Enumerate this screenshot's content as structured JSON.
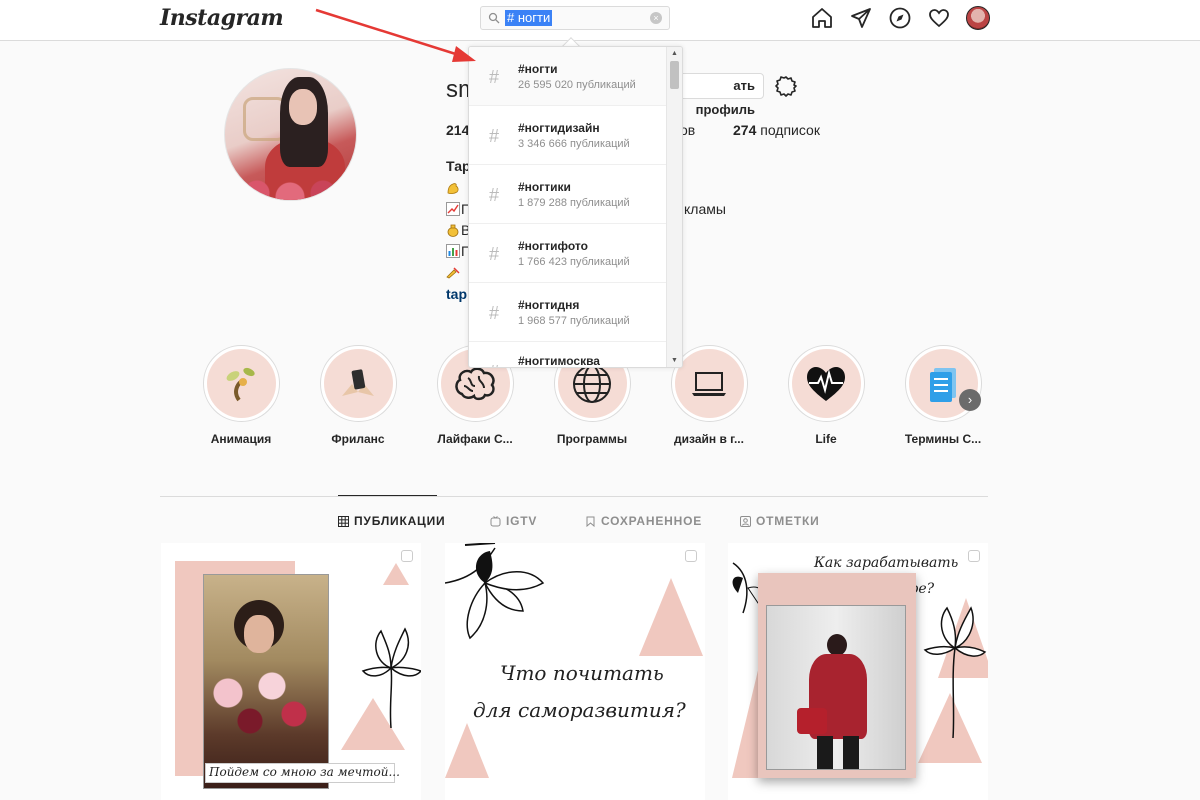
{
  "header": {
    "logo": "Instagram",
    "search_query": "# ногти",
    "clear_symbol": "×"
  },
  "dropdown": {
    "items": [
      {
        "hash": "#",
        "tag": "#ногти",
        "count": "26 595 020 публикаций"
      },
      {
        "hash": "#",
        "tag": "#ногтидизайн",
        "count": "3 346 666 публикаций"
      },
      {
        "hash": "#",
        "tag": "#ногтики",
        "count": "1 879 288 публикаций"
      },
      {
        "hash": "#",
        "tag": "#ногтифото",
        "count": "1 766 423 публикаций"
      },
      {
        "hash": "#",
        "tag": "#ногтидня",
        "count": "1 968 577 публикаций"
      },
      {
        "hash": "#",
        "tag": "#ногтимосква",
        "count": ""
      }
    ]
  },
  "profile": {
    "username_partial": "sm",
    "edit_button": "ать профиль",
    "posts_partial": "214",
    "followers_partial": "ов",
    "following_count": "274",
    "following_label": " подписок",
    "bio_name_partial": "Тар",
    "bio_lines": [
      "",
      "П",
      "В",
      "П",
      ""
    ],
    "bio_ads_partial": "кламы",
    "bio_link_partial": "tap"
  },
  "highlights": [
    {
      "label": "Анимация",
      "icon": "sprout-icon"
    },
    {
      "label": "Фриланс",
      "icon": "phone-hands-icon"
    },
    {
      "label": "Лайфаки С...",
      "icon": "brain-icon"
    },
    {
      "label": "Программы",
      "icon": "globe-icon"
    },
    {
      "label": "дизайн в г...",
      "icon": "laptop-icon"
    },
    {
      "label": "Life",
      "icon": "heart-pulse-icon"
    },
    {
      "label": "Термины С...",
      "icon": "document-icon"
    }
  ],
  "tabs": [
    {
      "label": "ПУБЛИКАЦИИ",
      "icon": "grid-icon",
      "active": true
    },
    {
      "label": "IGTV",
      "icon": "igtv-icon",
      "active": false
    },
    {
      "label": "СОХРАНЕННОЕ",
      "icon": "bookmark-icon",
      "active": false
    },
    {
      "label": "ОТМЕТКИ",
      "icon": "tag-user-icon",
      "active": false
    }
  ],
  "posts": [
    {
      "caption": "Пойдем со мною за мечтой..."
    },
    {
      "caption_line1": "Что почитать",
      "caption_line2": "для саморазвития?"
    },
    {
      "caption_line1": "Как зарабатывать",
      "caption_line2": "на Твиттере?"
    }
  ],
  "colors": {
    "accent_pink": "#f0c8bf",
    "annotation_arrow": "#e53935",
    "selection_blue": "#3b82f6"
  }
}
